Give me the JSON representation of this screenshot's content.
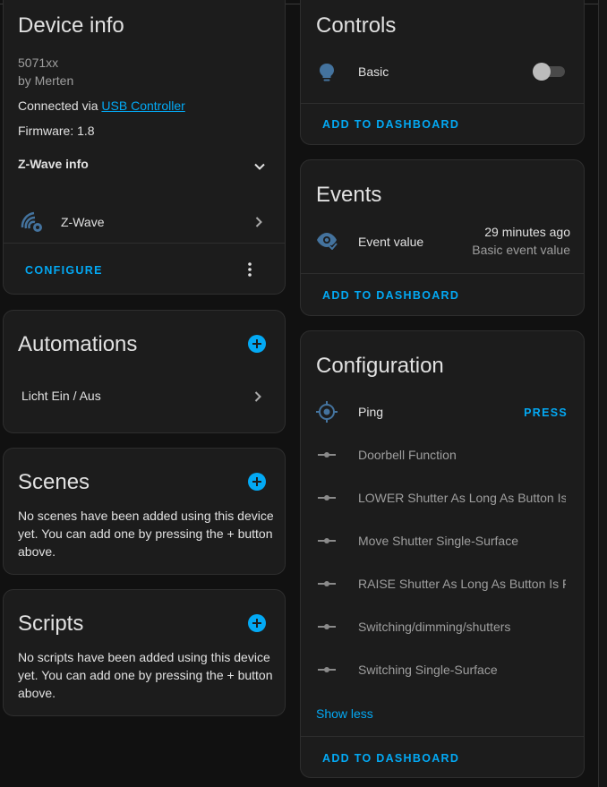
{
  "device_info": {
    "title": "Device info",
    "model": "5071xx",
    "manufacturer": "by Merten",
    "connected_prefix": "Connected via",
    "connected_link": "USB Controller",
    "firmware": "Firmware: 1.8",
    "zwave_info_label": "Z-Wave info",
    "integration_label": "Z-Wave",
    "configure_label": "CONFIGURE"
  },
  "automations": {
    "title": "Automations",
    "items": [
      "Licht Ein / Aus"
    ]
  },
  "scenes": {
    "title": "Scenes",
    "empty_text": "No scenes have been added using this device yet. You can add one by pressing the + button above."
  },
  "scripts": {
    "title": "Scripts",
    "empty_text": "No scripts have been added using this device yet. You can add one by pressing the + button above."
  },
  "controls": {
    "title": "Controls",
    "entity_label": "Basic",
    "toggle_on": false,
    "add_label": "ADD TO DASHBOARD"
  },
  "events": {
    "title": "Events",
    "entity_label": "Event value",
    "time": "29 minutes ago",
    "value": "Basic event value",
    "add_label": "ADD TO DASHBOARD"
  },
  "configuration": {
    "title": "Configuration",
    "ping_label": "Ping",
    "press_label": "PRESS",
    "items": [
      "Doorbell Function",
      "LOWER Shutter As Long As Button Is",
      "Move Shutter Single-Surface",
      "RAISE Shutter As Long As Button Is F",
      "Switching/dimming/shutters",
      "Switching Single-Surface"
    ],
    "show_less_label": "Show less",
    "add_label": "ADD TO DASHBOARD"
  },
  "colors": {
    "accent": "#03a9f4",
    "card_bg": "#1c1c1c",
    "page_bg": "#111111",
    "icon_blue": "#44739e"
  }
}
